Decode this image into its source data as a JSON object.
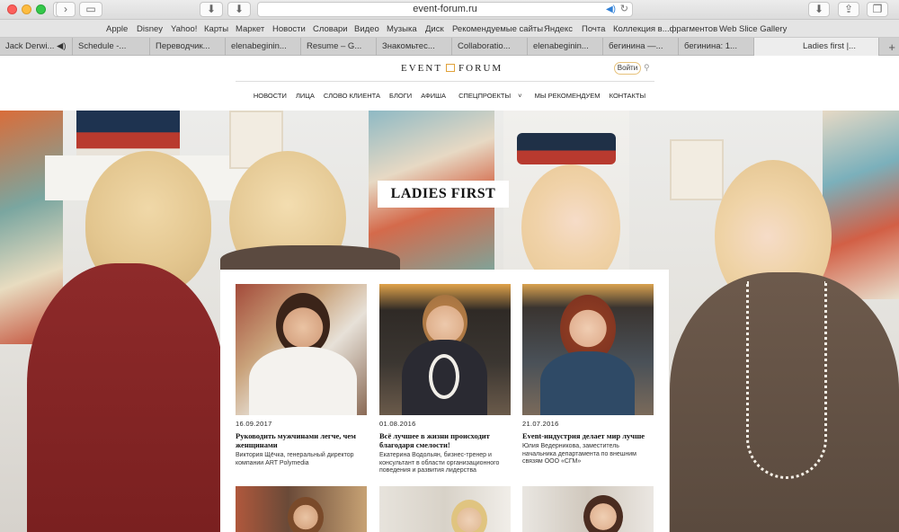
{
  "browser": {
    "url": "event-forum.ru",
    "bookmarks": [
      "Apple",
      "Disney",
      "Yahoo!",
      "Карты",
      "Маркет",
      "Новости",
      "Словари",
      "Видео",
      "Музыка",
      "Диск",
      "Рекомендуемые сайты",
      "Яндекс",
      "Почта",
      "Коллекция в...фрагментов",
      "Web Slice Gallery"
    ],
    "tabs": [
      "Jack Derwi...",
      "Schedule -...",
      "Переводчик...",
      "elenabeginin...",
      "Resume – G...",
      "Знакомьтес...",
      "Collaboratio...",
      "elenabeginin...",
      "бегинина —...",
      "бегинина: 1...",
      "Ladies first |..."
    ],
    "tab_plus": "+"
  },
  "site": {
    "logo_left": "EVENT",
    "logo_right": "FORUM",
    "login_label": "Войти",
    "menu": [
      "НОВОСТИ",
      "ЛИЦА",
      "СЛОВО КЛИЕНТА",
      "БЛОГИ",
      "АФИША",
      "СПЕЦПРОЕКТЫ",
      "МЫ РЕКОМЕНДУЕМ",
      "КОНТАКТЫ"
    ],
    "dropdown_marker": "˅"
  },
  "hero": {
    "title": "LADIES FIRST"
  },
  "articles": [
    {
      "date": "16.09.2017",
      "title": "Руководить мужчинами легче, чем женщинами",
      "desc": "Виктория Щёчка, генеральный директор компании ART Polymedia"
    },
    {
      "date": "01.08.2016",
      "title": "Всё лучшее в жизни происходит благодаря смелости!",
      "desc": "Екатерина Водольян, бизнес-тренер и консультант в области организационного поведения и развития лидерства"
    },
    {
      "date": "21.07.2016",
      "title": "Event-индустрия делает мир лучше",
      "desc": "Юлия Ведерникова, заместитель начальника департамента по внешним связям ООО «СГМ»"
    }
  ],
  "colors": {
    "accent": "#e0a23b",
    "background": "#ffffff",
    "text": "#111111"
  }
}
